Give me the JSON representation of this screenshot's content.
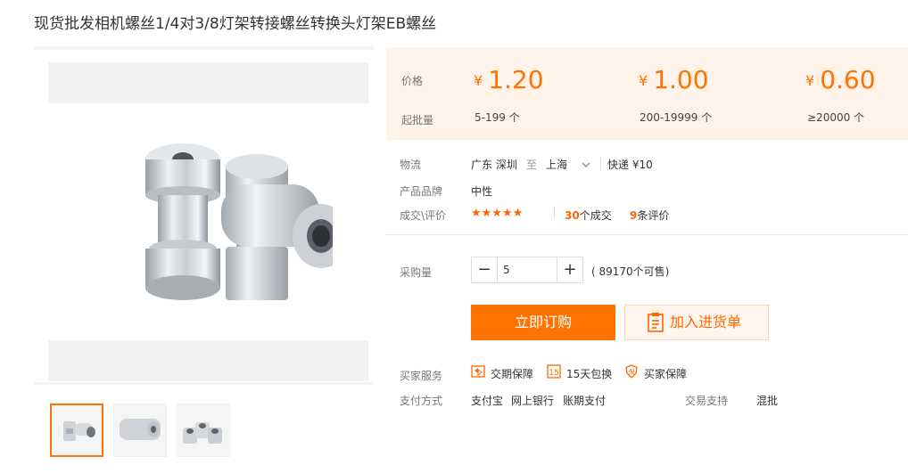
{
  "product_title": "现货批发相机螺丝1/4对3/8灯架转接螺丝转换头灯架EB螺丝",
  "price_panel": {
    "price_label": "价格",
    "moq_label": "起批量",
    "currency": "¥",
    "tiers": [
      {
        "price": "1.20",
        "range": "5-199 个"
      },
      {
        "price": "1.00",
        "range": "200-19999 个"
      },
      {
        "price": "0.60",
        "range": "≥20000 个"
      }
    ]
  },
  "logistics": {
    "label": "物流",
    "from": "广东 深圳",
    "to_word": "至",
    "to": "上海",
    "shipping": "快递 ¥10"
  },
  "brand": {
    "label": "产品品牌",
    "value": "中性"
  },
  "deals": {
    "label": "成交\\评价",
    "stars": "★★★★★",
    "deal_count": "30",
    "deal_suffix": "个成交",
    "review_count": "9",
    "review_suffix": "条评价"
  },
  "purchase": {
    "label": "采购量",
    "minus": "−",
    "plus": "+",
    "quantity": "5",
    "available": "( 89170个可售)"
  },
  "buttons": {
    "buy": "立即订购",
    "cart": "加入进货单"
  },
  "services": {
    "label": "买家服务",
    "items": [
      {
        "icon": "exchange-icon",
        "label": "交期保障"
      },
      {
        "icon": "15-day-icon",
        "label": "15天包换",
        "badge": "15"
      },
      {
        "icon": "protect-icon",
        "label": "买家保障",
        "badge": "保"
      }
    ]
  },
  "payment": {
    "label": "支付方式",
    "methods": [
      "支付宝",
      "网上银行",
      "账期支付"
    ],
    "trade_label": "交易支持",
    "trade_value": "混批"
  },
  "colors": {
    "accent": "#ff7300",
    "panel_bg": "#fff2e8"
  }
}
